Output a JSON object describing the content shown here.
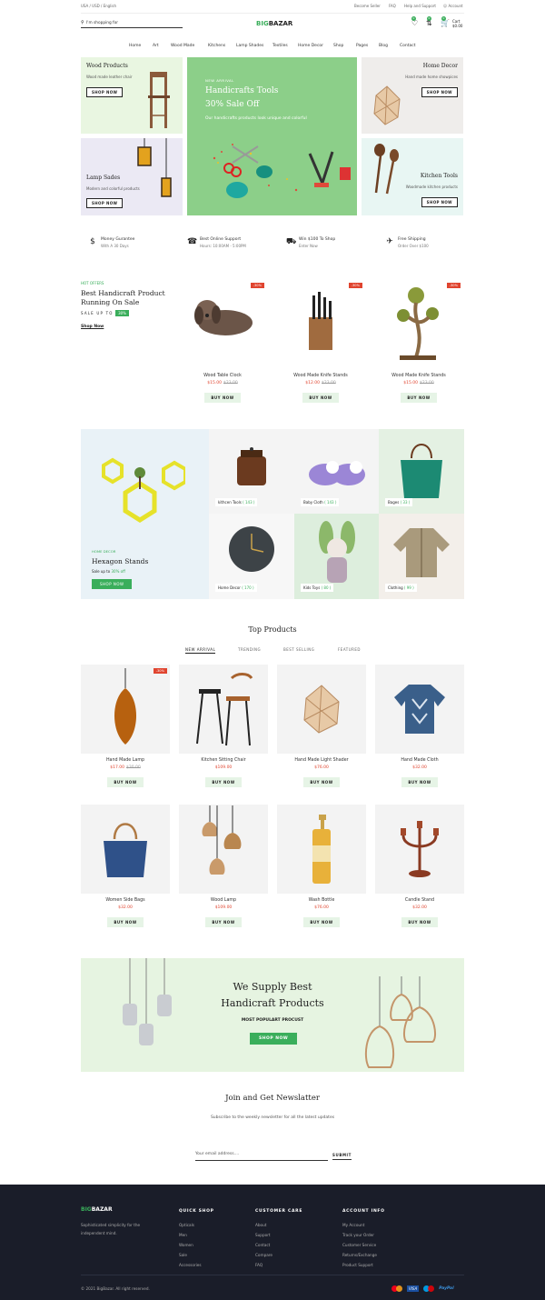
{
  "topbar": {
    "locale": "USA / USD / English",
    "become_seller": "Become Seller",
    "faq": "FAQ",
    "help": "Help and Support",
    "account": "Account"
  },
  "header": {
    "search_placeholder": "I'm shopping for",
    "logo_a": "BIG",
    "logo_b": "BAZAR",
    "cart_label": "Cart",
    "cart_total": "$0.00",
    "wishlist_count": "0",
    "compare_count": "0",
    "cart_count": "0"
  },
  "nav": [
    "Home",
    "Art",
    "Wood Made",
    "Kitchens",
    "Lamp Shades",
    "Textiles",
    "Home Decor",
    "Shop",
    "Pages",
    "Blog",
    "Contact"
  ],
  "hero": {
    "wood": {
      "title": "Wood Products",
      "sub": "Wood made leather chair",
      "btn": "SHOP NOW"
    },
    "lamp": {
      "title": "Lamp Sades",
      "sub": "Modern and colorful products",
      "btn": "SHOP NOW"
    },
    "center": {
      "tag": "NEW ARRIVAL",
      "title1": "Handicrafts Tools",
      "title2": "30% Sale Off",
      "sub": "Our handicrafts products look unique and colorful"
    },
    "decor": {
      "title": "Home Decor",
      "sub": "Hand made home showpices",
      "btn": "SHOP NOW"
    },
    "kitchen": {
      "title": "Kitchen Tools",
      "sub": "Woodmade kitchen products",
      "btn": "SHOP NOW"
    }
  },
  "features": [
    {
      "icon": "money-icon",
      "t": "Money Gurantee",
      "s": "With A 30 Days"
    },
    {
      "icon": "headset-icon",
      "t": "Best Online Support",
      "s": "Hours: 10:00AM - 5:00PM"
    },
    {
      "icon": "truck-icon",
      "t": "Win $100 To Shop",
      "s": "Enter Now"
    },
    {
      "icon": "plane-icon",
      "t": "Free Shipping",
      "s": "Order Over $100"
    }
  ],
  "hot": {
    "tag": "HOT OFFERS",
    "title1": "Best Handicraft Product",
    "title2": "Running On Sale",
    "sale": "SALE UP TO",
    "pct": "30%",
    "link": "Shop Now",
    "items": [
      {
        "name": "Wood Table Clock",
        "price": "$15.00",
        "old": "$23.00",
        "badge": "-30%",
        "btn": "BUY NOW"
      },
      {
        "name": "Wood Made Knife Stands",
        "price": "$12.00",
        "old": "$23.00",
        "badge": "-30%",
        "btn": "BUY NOW"
      },
      {
        "name": "Wood Made Knife Stands",
        "price": "$15.00",
        "old": "$23.00",
        "badge": "-30%",
        "btn": "BUY NOW"
      }
    ]
  },
  "hexagon": {
    "tag": "HOME DECOR",
    "title": "Hexagon Stands",
    "sale": "Sale up to",
    "pct": "30% off",
    "btn": "SHOP NOW"
  },
  "cats": [
    {
      "name": "kithcen Tools",
      "count": "( 143 )"
    },
    {
      "name": "Baby Cloth",
      "count": "( 143 )"
    },
    {
      "name": "Bages",
      "count": "( 33 )"
    },
    {
      "name": "Home Decor",
      "count": "( 170 )"
    },
    {
      "name": "Kids Toys",
      "count": "( 80 )"
    },
    {
      "name": "Clothing",
      "count": "( 99 )"
    }
  ],
  "top": {
    "title": "Top Products",
    "tabs": [
      "NEW ARRIVAL",
      "TRENDING",
      "BEST SELLING",
      "FEATURED"
    ],
    "items": [
      {
        "name": "Hand Made Lamp",
        "price": "$17.00",
        "old": "$30.00",
        "badge": "-30%",
        "btn": "BUY NOW"
      },
      {
        "name": "Kitchen Sitting Chair",
        "price": "$109.00",
        "old": "",
        "badge": "",
        "btn": "BUY NOW"
      },
      {
        "name": "Hand Made Light Shader",
        "price": "$76.00",
        "old": "",
        "badge": "",
        "btn": "BUY NOW"
      },
      {
        "name": "Hand Made Cloth",
        "price": "$32.00",
        "old": "",
        "badge": "",
        "btn": "BUY NOW"
      },
      {
        "name": "Women Side Bags",
        "price": "$32.00",
        "old": "",
        "badge": "",
        "btn": "BUY NOW"
      },
      {
        "name": "Wood Lamp",
        "price": "$109.00",
        "old": "",
        "badge": "",
        "btn": "BUY NOW"
      },
      {
        "name": "Wash Bottle",
        "price": "$76.00",
        "old": "",
        "badge": "",
        "btn": "BUY NOW"
      },
      {
        "name": "Candle Stand",
        "price": "$32.00",
        "old": "",
        "badge": "",
        "btn": "BUY NOW"
      }
    ]
  },
  "supply": {
    "title1": "We Supply Best",
    "title2": "Handicraft Products",
    "sub": "MOST POPULART PROCUST",
    "btn": "SHOP NOW"
  },
  "news": {
    "title": "Join and Get Newslatter",
    "sub": "Subscribe to the weekly newsletter for all the latest updates",
    "placeholder": "Your email address....",
    "btn": "SUBMIT"
  },
  "footer": {
    "logo_a": "BIG",
    "logo_b": "BAZAR",
    "about1": "Sophisticated simplicity for the",
    "about2": "independent mind.",
    "cols": [
      {
        "h": "QUICK SHOP",
        "items": [
          "Opticals",
          "Men",
          "Women",
          "Sale",
          "Accessories"
        ]
      },
      {
        "h": "CUSTOMER CARE",
        "items": [
          "About",
          "Support",
          "Contact",
          "Compare",
          "FAQ"
        ]
      },
      {
        "h": "ACCOUNT INFO",
        "items": [
          "My Account",
          "Track your Order",
          "Customer Service",
          "Returns/Exchange",
          "Product Support"
        ]
      }
    ],
    "copyright": "© 2021 BigBazar. All right reserved.",
    "pay": [
      "VISA",
      "PayPal"
    ]
  },
  "colors": {
    "green": "#3aae5b",
    "red": "#e0442f",
    "dark": "#1a1d29"
  }
}
